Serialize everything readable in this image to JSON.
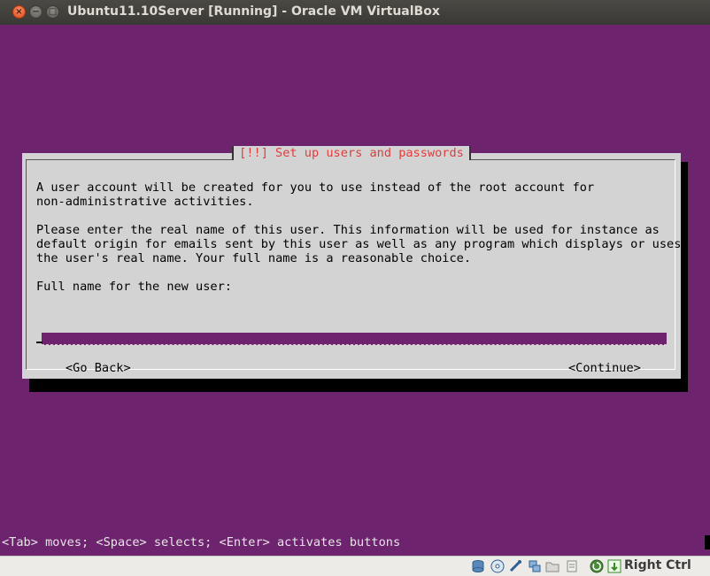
{
  "window": {
    "title": "Ubuntu11.10Server [Running] - Oracle VM VirtualBox",
    "buttons": {
      "close": "×",
      "minimize": "−",
      "maximize": "□"
    }
  },
  "dialog": {
    "title": "[!!] Set up users and passwords",
    "lines": [
      "A user account will be created for you to use instead of the root account for",
      "non-administrative activities.",
      "",
      "Please enter the real name of this user. This information will be used for instance as",
      "default origin for emails sent by this user as well as any program which displays or uses",
      "the user's real name. Your full name is a reasonable choice.",
      "",
      "Full name for the new user:"
    ],
    "input_value": "",
    "go_back_label": "<Go Back>",
    "continue_label": "<Continue>"
  },
  "help_line": "<Tab> moves; <Space> selects; <Enter> activates buttons",
  "statusbar": {
    "icons": [
      "hard-disk-icon",
      "optical-drive-icon",
      "usb-icon",
      "network-icon",
      "shared-folder-icon",
      "display-icon",
      "recording-icon",
      "mouse-integration-icon"
    ],
    "host_key": "Right Ctrl"
  },
  "colors": {
    "vm_background": "#6e236e",
    "dialog_background": "#d3d3d3",
    "dialog_title": "#e03c3c",
    "titlebar": "#3c3b37"
  }
}
